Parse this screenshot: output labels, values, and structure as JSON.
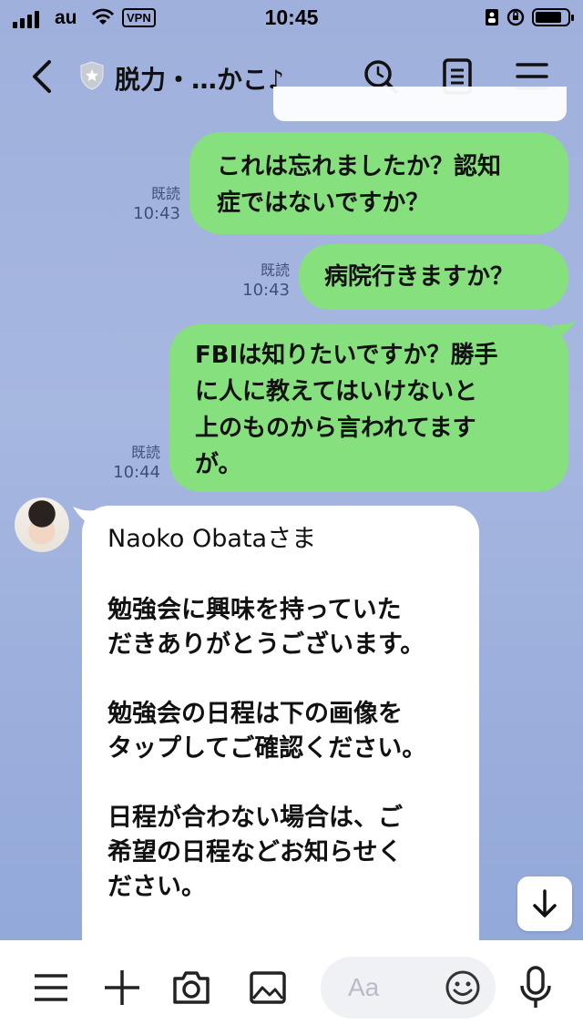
{
  "status_bar": {
    "carrier": "au",
    "vpn": "VPN",
    "time": "10:45"
  },
  "header": {
    "title": "脱力・…かこ♪"
  },
  "messages": [
    {
      "side": "out",
      "lines": [
        "これは忘れましたか？認知",
        "症ではないですか？"
      ],
      "read": "既読",
      "time": "10:43"
    },
    {
      "side": "out",
      "lines": [
        "病院行きますか？"
      ],
      "read": "既読",
      "time": "10:43"
    },
    {
      "side": "out",
      "lines": [
        "FBIは知りたいですか？勝手",
        "に人に教えてはいけないと",
        "上のものから言われてます",
        "が。"
      ],
      "read": "既読",
      "time": "10:44"
    },
    {
      "side": "in",
      "paragraphs": [
        [
          "Naoko Obataさま"
        ],
        [
          "勉強会に興味を持っていた",
          "だきありがとうございます。"
        ],
        [
          "勉強会の日程は下の画像を",
          "タップしてご確認ください。"
        ],
        [
          "日程が合わない場合は、ご",
          "希望の日程などお知らせく",
          "ださい。"
        ]
      ]
    }
  ],
  "input": {
    "placeholder": "Aa"
  },
  "colors": {
    "outgoing_bubble": "#86e07e",
    "incoming_bubble": "#ffffff",
    "background": "#9fb0dc"
  },
  "icons": [
    "back-icon",
    "shield-icon",
    "search-icon",
    "notes-icon",
    "menu-icon",
    "scroll-down-icon",
    "hamburger-icon",
    "plus-icon",
    "camera-icon",
    "image-icon",
    "emoji-icon",
    "mic-icon"
  ]
}
